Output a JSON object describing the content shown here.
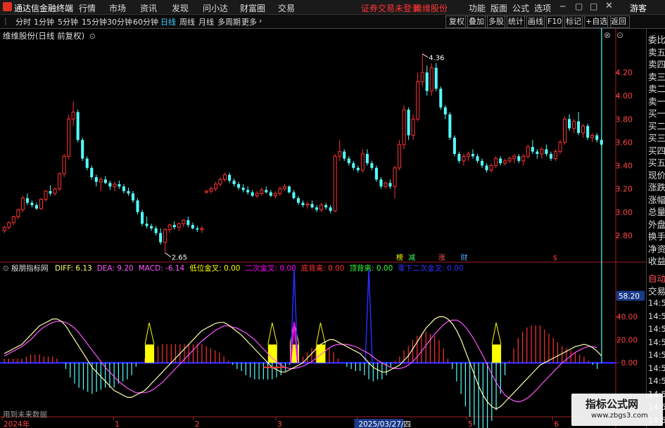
{
  "app": {
    "title": "通达信金融终端",
    "menus": [
      "行情",
      "市场",
      "资讯",
      "发现",
      "问小达",
      "财富圈",
      "交易"
    ],
    "notice": "证券交易未登录",
    "notice2": "维维股份",
    "right_menus": [
      "功能",
      "版面",
      "公式",
      "选项"
    ],
    "guest": "游客"
  },
  "toolbar": {
    "periods": [
      "分时",
      "1分钟",
      "5分钟",
      "15分钟",
      "30分钟",
      "60分钟",
      "日线",
      "周线",
      "月线",
      "多周期",
      "更多"
    ],
    "active": "日线",
    "right_buttons": [
      "复权",
      "叠加",
      "多股",
      "统计",
      "画线",
      "F10",
      "标记",
      "+自选",
      "返回"
    ]
  },
  "main_chart": {
    "stock_label": "维维股份(日线 前复权)",
    "y_ticks": [
      "4.20",
      "4.00",
      "3.80",
      "3.60",
      "3.40",
      "3.20",
      "3.00",
      "2.80"
    ],
    "ylim": [
      2.6,
      4.4
    ],
    "high_label": "4.36",
    "low_label": "2.65",
    "markers": [
      "榜",
      "减",
      "涨",
      "财",
      "$"
    ]
  },
  "indicator": {
    "name": "殷朋指标网",
    "params": [
      {
        "label": "DIFF: 6.13",
        "color": "#ffff66"
      },
      {
        "label": "DEA: 9.20",
        "color": "#ff55ff"
      },
      {
        "label": "MACD: -6.14",
        "color": "#ff55ff"
      },
      {
        "label": "低位金叉: 0.00",
        "color": "#ffff00"
      },
      {
        "label": "二次金叉: 0.00",
        "color": "#ff00ff"
      },
      {
        "label": "底背离: 0.00",
        "color": "#ff3333"
      },
      {
        "label": "顶背离: 0.00",
        "color": "#33ff33"
      },
      {
        "label": "零下二次金叉: 0.00",
        "color": "#3333ff"
      }
    ],
    "y_ticks": [
      "58.20",
      "40.00",
      "20.00",
      "0.00"
    ],
    "current_tick": "58.20",
    "footnote": "用到未来数据"
  },
  "time_axis": {
    "labels": [
      "2024年",
      "1",
      "2",
      "3",
      "2025/03/27/四",
      "5",
      "6"
    ],
    "highlight": "2025/03/27/四"
  },
  "sidebar": {
    "items": [
      "委比",
      "卖五",
      "卖四",
      "卖三",
      "卖二",
      "卖一",
      "买一",
      "买二",
      "买三",
      "买四",
      "买五",
      "现价",
      "涨跌",
      "涨幅",
      "总量",
      "外盘",
      "换手",
      "净资",
      "收益"
    ],
    "bottom_items": [
      "自动",
      "交易"
    ],
    "right_times": [
      "14:56",
      "14:56",
      "14:56",
      "14:56",
      "14:56",
      "14:56",
      "14:56",
      "14:56",
      "14:56",
      "14:56"
    ]
  },
  "watermark": {
    "text": "指标公式网",
    "url": "www.zbgs3.com"
  },
  "chart_data": {
    "type": "candlestick",
    "series": [
      {
        "ohlc": [
          [
            2.84,
            2.88,
            2.82,
            2.87
          ],
          [
            2.87,
            2.92,
            2.85,
            2.91
          ],
          [
            2.91,
            2.97,
            2.89,
            2.96
          ],
          [
            2.96,
            3.03,
            2.94,
            3.02
          ],
          [
            3.02,
            3.14,
            3.0,
            3.12
          ],
          [
            3.12,
            3.16,
            3.06,
            3.08
          ],
          [
            3.08,
            3.1,
            3.04,
            3.06
          ],
          [
            3.06,
            3.08,
            3.02,
            3.03
          ],
          [
            3.03,
            3.12,
            3.02,
            3.11
          ],
          [
            3.11,
            3.19,
            3.09,
            3.18
          ],
          [
            3.18,
            3.23,
            3.14,
            3.16
          ],
          [
            3.16,
            3.21,
            3.14,
            3.2
          ],
          [
            3.2,
            3.34,
            3.18,
            3.33
          ],
          [
            3.33,
            3.5,
            3.3,
            3.48
          ],
          [
            3.48,
            3.84,
            3.45,
            3.8
          ],
          [
            3.8,
            3.95,
            3.74,
            3.86
          ],
          [
            3.86,
            3.88,
            3.6,
            3.62
          ],
          [
            3.62,
            3.64,
            3.44,
            3.46
          ],
          [
            3.46,
            3.48,
            3.36,
            3.38
          ],
          [
            3.38,
            3.4,
            3.28,
            3.3
          ],
          [
            3.3,
            3.32,
            3.22,
            3.26
          ],
          [
            3.26,
            3.3,
            3.18,
            3.28
          ],
          [
            3.28,
            3.31,
            3.24,
            3.25
          ],
          [
            3.25,
            3.27,
            3.19,
            3.22
          ],
          [
            3.22,
            3.26,
            3.18,
            3.24
          ],
          [
            3.24,
            3.27,
            3.2,
            3.22
          ],
          [
            3.22,
            3.24,
            3.16,
            3.18
          ],
          [
            3.18,
            3.21,
            3.14,
            3.16
          ],
          [
            3.16,
            3.18,
            3.08,
            3.1
          ],
          [
            3.1,
            3.12,
            2.98,
            3.0
          ],
          [
            3.0,
            3.02,
            2.88,
            2.9
          ],
          [
            2.9,
            2.96,
            2.86,
            2.88
          ],
          [
            2.88,
            2.9,
            2.84,
            2.86
          ],
          [
            2.86,
            2.88,
            2.8,
            2.82
          ],
          [
            2.82,
            2.86,
            2.72,
            2.74
          ],
          [
            2.74,
            2.86,
            2.65,
            2.85
          ],
          [
            2.85,
            2.9,
            2.82,
            2.89
          ],
          [
            2.89,
            2.92,
            2.85,
            2.87
          ],
          [
            2.87,
            2.91,
            2.84,
            2.9
          ],
          [
            2.9,
            2.94,
            2.87,
            2.93
          ],
          [
            2.93,
            2.96,
            2.87,
            2.89
          ],
          [
            2.89,
            2.91,
            2.85,
            2.86
          ],
          [
            2.86,
            2.88,
            2.83,
            2.85
          ],
          [
            2.85,
            2.88,
            2.82,
            2.86
          ],
          [
            3.17,
            3.19,
            3.16,
            3.18
          ],
          [
            3.18,
            3.22,
            3.16,
            3.2
          ],
          [
            3.2,
            3.26,
            3.18,
            3.24
          ],
          [
            3.24,
            3.3,
            3.22,
            3.28
          ],
          [
            3.28,
            3.34,
            3.26,
            3.32
          ],
          [
            3.32,
            3.34,
            3.25,
            3.27
          ],
          [
            3.27,
            3.29,
            3.22,
            3.24
          ],
          [
            3.24,
            3.26,
            3.19,
            3.21
          ],
          [
            3.21,
            3.24,
            3.17,
            3.19
          ],
          [
            3.19,
            3.22,
            3.15,
            3.17
          ],
          [
            3.17,
            3.19,
            3.13,
            3.14
          ],
          [
            3.14,
            3.18,
            3.12,
            3.16
          ],
          [
            3.16,
            3.21,
            3.14,
            3.19
          ],
          [
            3.19,
            3.22,
            3.16,
            3.17
          ],
          [
            3.17,
            3.19,
            3.13,
            3.14
          ],
          [
            3.14,
            3.18,
            3.12,
            3.16
          ],
          [
            3.16,
            3.22,
            3.14,
            3.2
          ],
          [
            3.2,
            3.24,
            3.18,
            3.22
          ],
          [
            3.22,
            3.23,
            3.16,
            3.17
          ],
          [
            3.17,
            3.19,
            3.11,
            3.12
          ],
          [
            3.12,
            3.14,
            3.06,
            3.08
          ],
          [
            3.08,
            3.1,
            3.04,
            3.06
          ],
          [
            3.06,
            3.09,
            3.03,
            3.07
          ],
          [
            3.07,
            3.1,
            3.03,
            3.04
          ],
          [
            3.04,
            3.06,
            3.0,
            3.02
          ],
          [
            3.02,
            3.08,
            3.0,
            3.06
          ],
          [
            3.06,
            3.08,
            3.02,
            3.04
          ],
          [
            3.04,
            3.06,
            2.99,
            3.01
          ],
          [
            3.01,
            3.5,
            3.0,
            3.48
          ],
          [
            3.48,
            3.62,
            3.44,
            3.52
          ],
          [
            3.52,
            3.54,
            3.44,
            3.46
          ],
          [
            3.46,
            3.48,
            3.4,
            3.42
          ],
          [
            3.42,
            3.44,
            3.36,
            3.38
          ],
          [
            3.38,
            3.4,
            3.34,
            3.36
          ],
          [
            3.36,
            3.54,
            3.34,
            3.5
          ],
          [
            3.5,
            3.54,
            3.4,
            3.42
          ],
          [
            3.42,
            3.44,
            3.36,
            3.38
          ],
          [
            3.38,
            3.4,
            3.26,
            3.28
          ],
          [
            3.28,
            3.3,
            3.2,
            3.22
          ],
          [
            3.22,
            3.26,
            3.2,
            3.25
          ],
          [
            3.25,
            3.28,
            3.2,
            3.22
          ],
          [
            3.22,
            3.4,
            3.12,
            3.38
          ],
          [
            3.38,
            3.62,
            3.36,
            3.58
          ],
          [
            3.58,
            3.92,
            3.54,
            3.88
          ],
          [
            3.88,
            3.9,
            3.62,
            3.66
          ],
          [
            3.66,
            3.84,
            3.62,
            3.8
          ],
          [
            3.8,
            4.2,
            3.78,
            4.12
          ],
          [
            4.12,
            4.36,
            4.08,
            4.2
          ],
          [
            4.2,
            4.26,
            4.0,
            4.04
          ],
          [
            4.04,
            4.28,
            4.0,
            4.24
          ],
          [
            4.24,
            4.28,
            4.04,
            4.06
          ],
          [
            4.06,
            4.08,
            3.88,
            3.9
          ],
          [
            3.9,
            3.92,
            3.8,
            3.84
          ],
          [
            3.84,
            3.86,
            3.62,
            3.64
          ],
          [
            3.64,
            3.66,
            3.48,
            3.5
          ],
          [
            3.5,
            3.52,
            3.42,
            3.44
          ],
          [
            3.44,
            3.5,
            3.4,
            3.48
          ],
          [
            3.48,
            3.52,
            3.44,
            3.5
          ],
          [
            3.5,
            3.54,
            3.46,
            3.48
          ],
          [
            3.48,
            3.5,
            3.42,
            3.44
          ],
          [
            3.44,
            3.46,
            3.38,
            3.4
          ],
          [
            3.4,
            3.42,
            3.34,
            3.36
          ],
          [
            3.36,
            3.42,
            3.34,
            3.4
          ],
          [
            3.4,
            3.48,
            3.38,
            3.46
          ],
          [
            3.46,
            3.48,
            3.4,
            3.42
          ],
          [
            3.42,
            3.46,
            3.4,
            3.44
          ],
          [
            3.44,
            3.48,
            3.42,
            3.46
          ],
          [
            3.46,
            3.5,
            3.42,
            3.48
          ],
          [
            3.48,
            3.5,
            3.42,
            3.44
          ],
          [
            3.44,
            3.5,
            3.4,
            3.48
          ],
          [
            3.48,
            3.58,
            3.46,
            3.56
          ],
          [
            3.56,
            3.62,
            3.5,
            3.52
          ],
          [
            3.52,
            3.54,
            3.46,
            3.5
          ],
          [
            3.5,
            3.56,
            3.46,
            3.54
          ],
          [
            3.54,
            3.58,
            3.48,
            3.5
          ],
          [
            3.5,
            3.52,
            3.44,
            3.46
          ],
          [
            3.46,
            3.54,
            3.44,
            3.52
          ],
          [
            3.52,
            3.62,
            3.5,
            3.6
          ],
          [
            3.6,
            3.82,
            3.58,
            3.8
          ],
          [
            3.8,
            3.84,
            3.7,
            3.72
          ],
          [
            3.72,
            3.8,
            3.68,
            3.78
          ],
          [
            3.78,
            3.86,
            3.66,
            3.68
          ],
          [
            3.68,
            3.76,
            3.64,
            3.74
          ],
          [
            3.74,
            3.76,
            3.62,
            3.64
          ],
          [
            3.64,
            3.68,
            3.6,
            3.66
          ],
          [
            3.66,
            3.68,
            3.6,
            3.62
          ],
          [
            3.62,
            3.64,
            3.56,
            3.58
          ]
        ]
      }
    ],
    "ylim": [
      2.6,
      4.4
    ],
    "macd": {
      "diff": [
        8,
        10,
        12,
        14,
        16,
        20,
        24,
        28,
        32,
        34,
        36,
        38,
        38,
        36,
        32,
        26,
        20,
        14,
        8,
        2,
        -4,
        -8,
        -12,
        -16,
        -20,
        -24,
        -26,
        -28,
        -30,
        -30,
        -28,
        -26,
        -24,
        -20,
        -16,
        -12,
        -8,
        -4,
        0,
        4,
        8,
        12,
        16,
        20,
        24,
        28,
        30,
        32,
        34,
        35,
        35,
        33,
        30,
        27,
        24,
        20,
        16,
        12,
        8,
        4,
        0,
        -4,
        -6,
        -8,
        -8,
        -6,
        -4,
        -2,
        0,
        4,
        8,
        12,
        16,
        18,
        20,
        20,
        18,
        16,
        14,
        12,
        10,
        8,
        4,
        0,
        -4,
        -6,
        -8,
        -8,
        -6,
        -4,
        -2,
        2,
        6,
        12,
        18,
        24,
        30,
        34,
        38,
        40,
        40,
        38,
        34,
        28,
        20,
        10,
        0,
        -10,
        -20,
        -28,
        -34,
        -38,
        -40,
        -38,
        -34,
        -30,
        -26,
        -22,
        -18,
        -14,
        -10,
        -6,
        -2,
        0,
        2,
        4,
        6,
        8,
        10,
        12,
        14,
        15,
        16,
        15,
        13,
        10,
        6
      ],
      "dea": [
        6,
        8,
        10,
        12,
        14,
        17,
        20,
        24,
        28,
        31,
        33,
        35,
        36,
        36,
        35,
        33,
        30,
        26,
        21,
        16,
        11,
        6,
        1,
        -4,
        -8,
        -12,
        -16,
        -19,
        -22,
        -24,
        -26,
        -26,
        -26,
        -25,
        -23,
        -20,
        -17,
        -13,
        -9,
        -5,
        -1,
        3,
        7,
        11,
        15,
        19,
        22,
        25,
        28,
        30,
        32,
        32,
        31,
        30,
        28,
        26,
        23,
        20,
        16,
        12,
        8,
        4,
        1,
        -2,
        -4,
        -5,
        -5,
        -4,
        -3,
        -1,
        1,
        4,
        7,
        10,
        13,
        15,
        16,
        16,
        16,
        15,
        14,
        12,
        10,
        8,
        5,
        2,
        0,
        -2,
        -4,
        -5,
        -5,
        -4,
        -2,
        1,
        5,
        10,
        15,
        20,
        25,
        29,
        33,
        36,
        37,
        37,
        35,
        31,
        26,
        20,
        13,
        6,
        -2,
        -10,
        -17,
        -23,
        -28,
        -31,
        -33,
        -34,
        -33,
        -31,
        -28,
        -24,
        -20,
        -16,
        -12,
        -8,
        -4,
        0,
        3,
        6,
        9,
        11,
        13,
        14,
        14,
        13
      ]
    }
  }
}
